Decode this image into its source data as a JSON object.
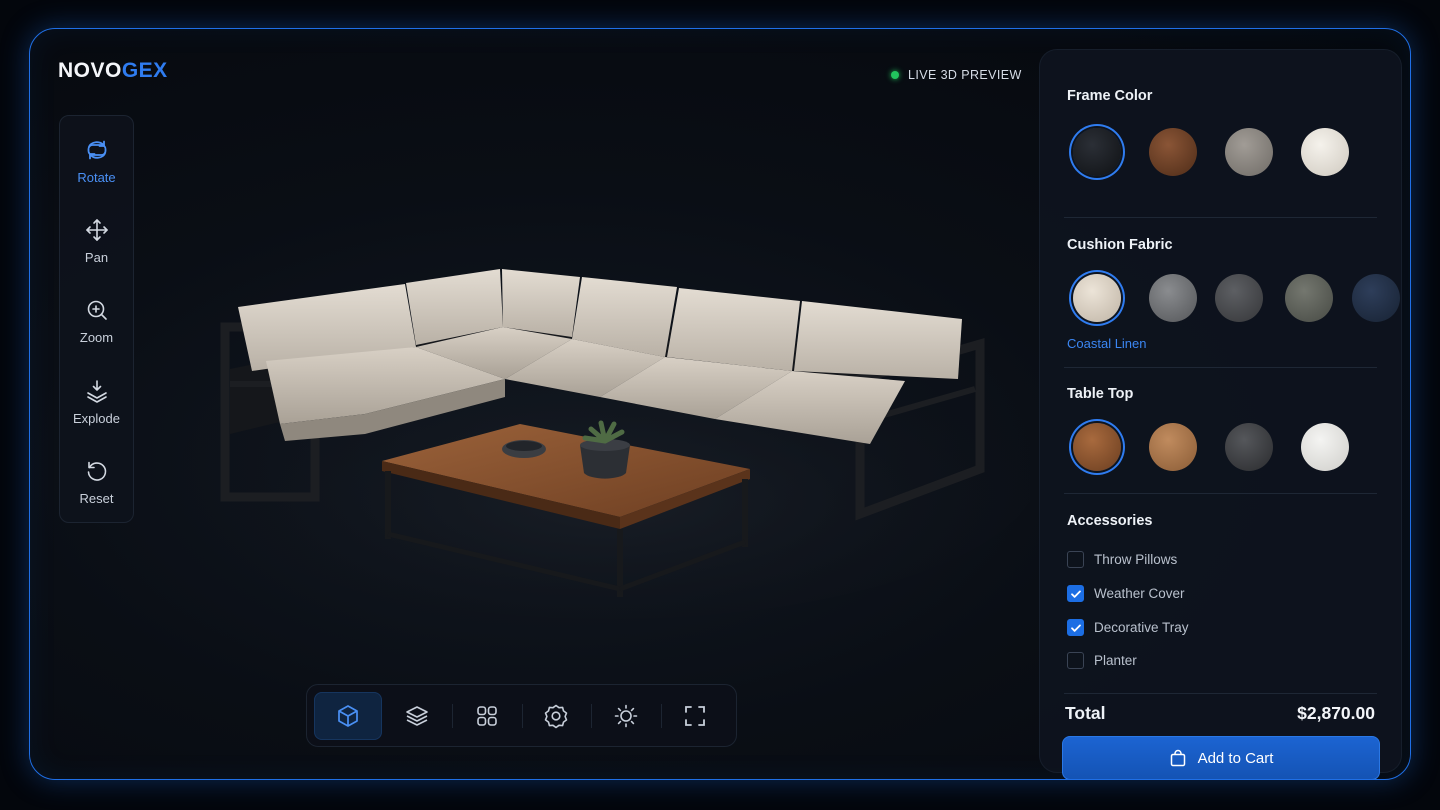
{
  "brand": {
    "part1": "NOVO",
    "part2": "GEX"
  },
  "live_label": "LIVE 3D PREVIEW",
  "tools": [
    {
      "label": "Rotate",
      "icon": "rotate-icon",
      "active": true
    },
    {
      "label": "Pan",
      "icon": "move-arrows-icon",
      "active": false
    },
    {
      "label": "Zoom",
      "icon": "zoom-icon",
      "active": false
    },
    {
      "label": "Explode",
      "icon": "explode-layers-icon",
      "active": false
    },
    {
      "label": "Reset",
      "icon": "reset-icon",
      "active": false
    }
  ],
  "bottom_toolbar": [
    {
      "icon": "cube-icon",
      "active": true
    },
    {
      "icon": "layers-icon",
      "active": false
    },
    {
      "icon": "grid-icon",
      "active": false
    },
    {
      "icon": "settings-gear-icon",
      "active": false
    },
    {
      "icon": "lighting-sun-icon",
      "active": false
    },
    {
      "icon": "fullscreen-icon",
      "active": false
    }
  ],
  "panel": {
    "frame_color": {
      "title": "Frame Color",
      "swatches": [
        "#16191e",
        "#6b4028",
        "#8a8681",
        "#e6e1d9"
      ],
      "selected_index": 0
    },
    "cushion_fabric": {
      "title": "Cushion Fabric",
      "swatches": [
        "#d9d0c4",
        "#6e7072",
        "#48494c",
        "#5b5e58",
        "#1f2c42"
      ],
      "selected_index": 0,
      "selected_name": "Coastal Linen"
    },
    "table_top": {
      "title": "Table Top",
      "swatches": [
        "#8a552f",
        "#a8754c",
        "#3c3d40",
        "#e5e4e1"
      ],
      "selected_index": 0
    },
    "accessories": {
      "title": "Accessories",
      "items": [
        {
          "label": "Throw Pillows",
          "checked": false
        },
        {
          "label": "Weather Cover",
          "checked": true
        },
        {
          "label": "Decorative Tray",
          "checked": true
        },
        {
          "label": "Planter",
          "checked": false
        }
      ]
    },
    "total_label": "Total",
    "total_value": "$2,870.00",
    "cart_label": "Add to Cart"
  },
  "colors": {
    "accent": "#2f7cf0",
    "frame_glow": "#1f6fe6",
    "live_dot": "#22c55e"
  }
}
